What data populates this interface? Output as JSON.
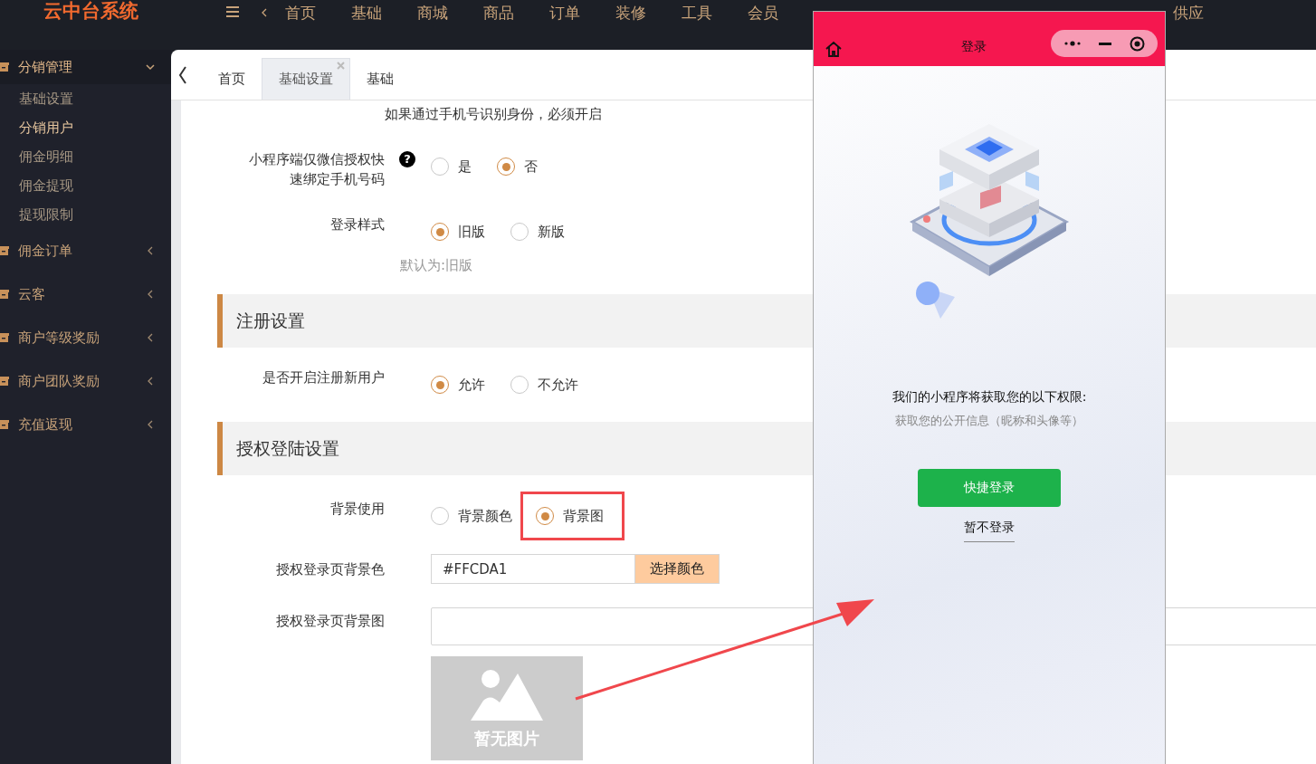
{
  "app": {
    "logo": "云中台系统"
  },
  "top_menu": [
    "首页",
    "基础",
    "商城",
    "商品",
    "订单",
    "装修",
    "工具",
    "会员"
  ],
  "top_menu_right": [
    "供应"
  ],
  "sidebar": [
    {
      "label": "分销管理",
      "expanded": true,
      "children": [
        {
          "label": "基础设置",
          "selected": false
        },
        {
          "label": "分销用户",
          "selected": true
        },
        {
          "label": "佣金明细",
          "selected": false
        },
        {
          "label": "佣金提现",
          "selected": false
        },
        {
          "label": "提现限制",
          "selected": false
        }
      ]
    },
    {
      "label": "佣金订单",
      "expanded": false
    },
    {
      "label": "云客",
      "expanded": false
    },
    {
      "label": "商户等级奖励",
      "expanded": false
    },
    {
      "label": "商户团队奖励",
      "expanded": false
    },
    {
      "label": "充值返现",
      "expanded": false
    }
  ],
  "tabs": [
    {
      "label": "首页",
      "selected": false,
      "closable": false
    },
    {
      "label": "基础设置",
      "selected": true,
      "closable": true
    },
    {
      "label": "基础",
      "selected": false,
      "closable": false
    }
  ],
  "form_rows": [
    {
      "kind": "note",
      "text": "如果通过手机号识别身份，必须开启"
    },
    {
      "kind": "radio",
      "label": "小程序端仅微信授权快速绑定手机号码",
      "help": "?",
      "options": [
        {
          "label": "是",
          "selected": false,
          "highlighted": false
        },
        {
          "label": "否",
          "selected": true,
          "highlighted": false
        }
      ]
    },
    {
      "kind": "radio",
      "label": "登录样式",
      "options": [
        {
          "label": "旧版",
          "selected": true,
          "highlighted": false
        },
        {
          "label": "新版",
          "selected": false,
          "highlighted": false
        }
      ],
      "hint": "默认为:旧版"
    },
    {
      "kind": "section",
      "title": "注册设置"
    },
    {
      "kind": "radio",
      "label": "是否开启注册新用户",
      "options": [
        {
          "label": "允许",
          "selected": true,
          "highlighted": false
        },
        {
          "label": "不允许",
          "selected": false,
          "highlighted": false
        }
      ]
    },
    {
      "kind": "section",
      "title": "授权登陆设置"
    },
    {
      "kind": "radio",
      "label": "背景使用",
      "options": [
        {
          "label": "背景颜色",
          "selected": false,
          "highlighted": false
        },
        {
          "label": "背景图",
          "selected": true,
          "highlighted": true
        }
      ]
    },
    {
      "kind": "color",
      "label": "授权登录页背景色",
      "value": "#FFCDA1",
      "button": "选择颜色"
    },
    {
      "kind": "image",
      "label": "授权登录页背景图",
      "empty_text": "暂无图片"
    }
  ],
  "phone": {
    "title": "登录",
    "permission_title": "我们的小程序将获取您的以下权限:",
    "permission_detail": "获取您的公开信息（昵称和头像等）",
    "primary_button": "快捷登录",
    "secondary_link": "暂不登录"
  }
}
